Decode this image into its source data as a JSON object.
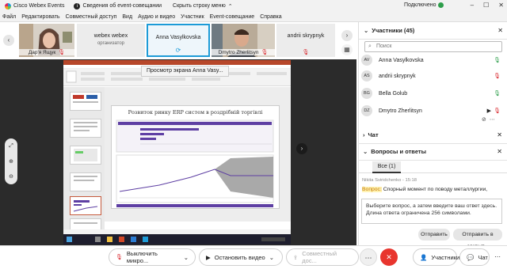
{
  "titlebar": {
    "app_name": "Cisco Webex Events",
    "event_info": "Сведения об event-совещании",
    "hide_menu": "Скрыть строку меню",
    "connection": "Подключено"
  },
  "menu": [
    "Файл",
    "Редактировать",
    "Совместный доступ",
    "Вид",
    "Аудио и видео",
    "Участник",
    "Event-совещание",
    "Справка"
  ],
  "strip": {
    "tiles": [
      {
        "name": "Дар'я Ящук",
        "role": "",
        "has_video": true
      },
      {
        "name": "webex webex",
        "role": "организатор",
        "has_video": false
      },
      {
        "name": "Anna Vasylkovska",
        "role": "",
        "has_video": false,
        "active": true
      },
      {
        "name": "Dmytro Zherlitsyn",
        "role": "",
        "has_video": true
      },
      {
        "name": "andrii skrypnyk",
        "role": "",
        "has_video": false
      }
    ]
  },
  "share": {
    "label": "Просмотр экрана Anna Vasy..."
  },
  "slide": {
    "title": "Розвиток ринку ERP систем в роздрібній торгівлі"
  },
  "panel": {
    "participants_header": "Участники (45)",
    "search_placeholder": "Поиск",
    "participants": [
      {
        "initials": "AV",
        "name": "Anna Vasylkovska",
        "mic": "on"
      },
      {
        "initials": "AS",
        "name": "andrii skrypnyk",
        "mic": "muted"
      },
      {
        "initials": "BG",
        "name": "Bella Golub",
        "mic": "on"
      },
      {
        "initials": "DZ",
        "name": "Dmytro Zherlitsyn",
        "mic": "muted"
      }
    ],
    "chat_header": "Чат",
    "qa_header": "Вопросы и ответы",
    "qa_tab": "Все (1)",
    "question_meta": "Nikita Sviridchenko - 15:18",
    "question_label": "Вопрос:",
    "question_text": "Спорный момент по поводу металлургии,",
    "answer_placeholder": "Выберите вопрос, а затем введите ваш ответ здесь. Длина ответа ограничена 256 символами.",
    "send_label": "Отправить",
    "send_private_label": "Отправить в закрыт..."
  },
  "controls": {
    "mute": "Выключить микро...",
    "video": "Остановить видео",
    "share": "Совместный дос...",
    "participants": "Участники",
    "chat": "Чат"
  },
  "colors": {
    "accent_blue": "#1d9bd7",
    "mic_red": "#d8262c",
    "mic_green": "#2e9e4b",
    "end_red": "#e8352e",
    "chart_purple": "#5e3fa3",
    "ppt_orange": "#b7472a"
  }
}
